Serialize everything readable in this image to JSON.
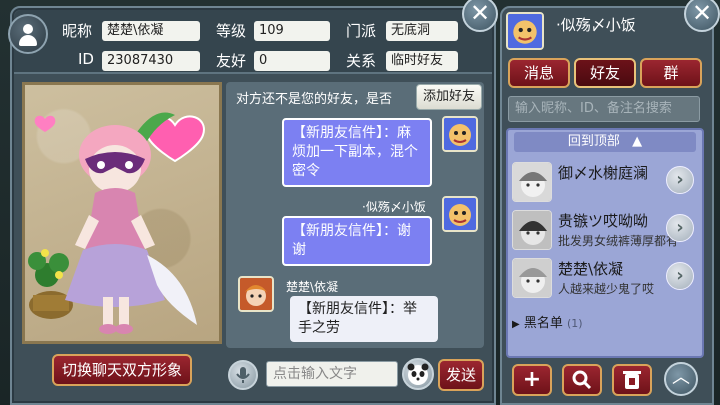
{
  "profile": {
    "nickname_label": "昵称",
    "nickname": "楚楚\\依凝",
    "level_label": "等级",
    "level": "109",
    "sect_label": "门派",
    "sect": "无底洞",
    "id_label": "ID",
    "id": "23087430",
    "friendship_label": "友好",
    "friendship": "0",
    "relation_label": "关系",
    "relation": "临时好友"
  },
  "chat": {
    "not_friend_notice": "对方还不是您的好友，是否",
    "add_friend_label": "添加好友",
    "messages": [
      {
        "sender": "",
        "text_line1": "【新朋友信件】：麻",
        "text_line2": "烦加一下副本，混个",
        "text_line3": "密令"
      },
      {
        "sender": "·似殇〆小饭",
        "text_line1": "【新朋友信件】：谢",
        "text_line2": "谢"
      },
      {
        "sender": "楚楚\\依凝",
        "text_line1": "【新朋友信件】：举",
        "text_line2": "手之劳"
      }
    ],
    "input_placeholder": "点击输入文字",
    "send_label": "发送",
    "switch_label": "切换聊天双方形象"
  },
  "right": {
    "me_name": "·似殇〆小饭",
    "tabs": [
      "消息",
      "好友",
      "群"
    ],
    "search_placeholder": "输入昵称、ID、备注名搜索",
    "back_top_label": "回到顶部",
    "friends": [
      {
        "name": "御〆水榭庭澜",
        "signature": ""
      },
      {
        "name": "贵镞ツ哎呦呦",
        "signature": "批发男女绒裤薄厚都有"
      },
      {
        "name": "楚楚\\依凝",
        "signature": "人越来越少鬼了哎"
      }
    ],
    "blacklist_label": "黑名单",
    "blacklist_count": "(1)"
  },
  "colors": {
    "panel_bg": "#3f4f58",
    "accent_red": "#9b2630",
    "bubble_purple": "#7c80f2",
    "list_bg": "#9ba6d6"
  }
}
